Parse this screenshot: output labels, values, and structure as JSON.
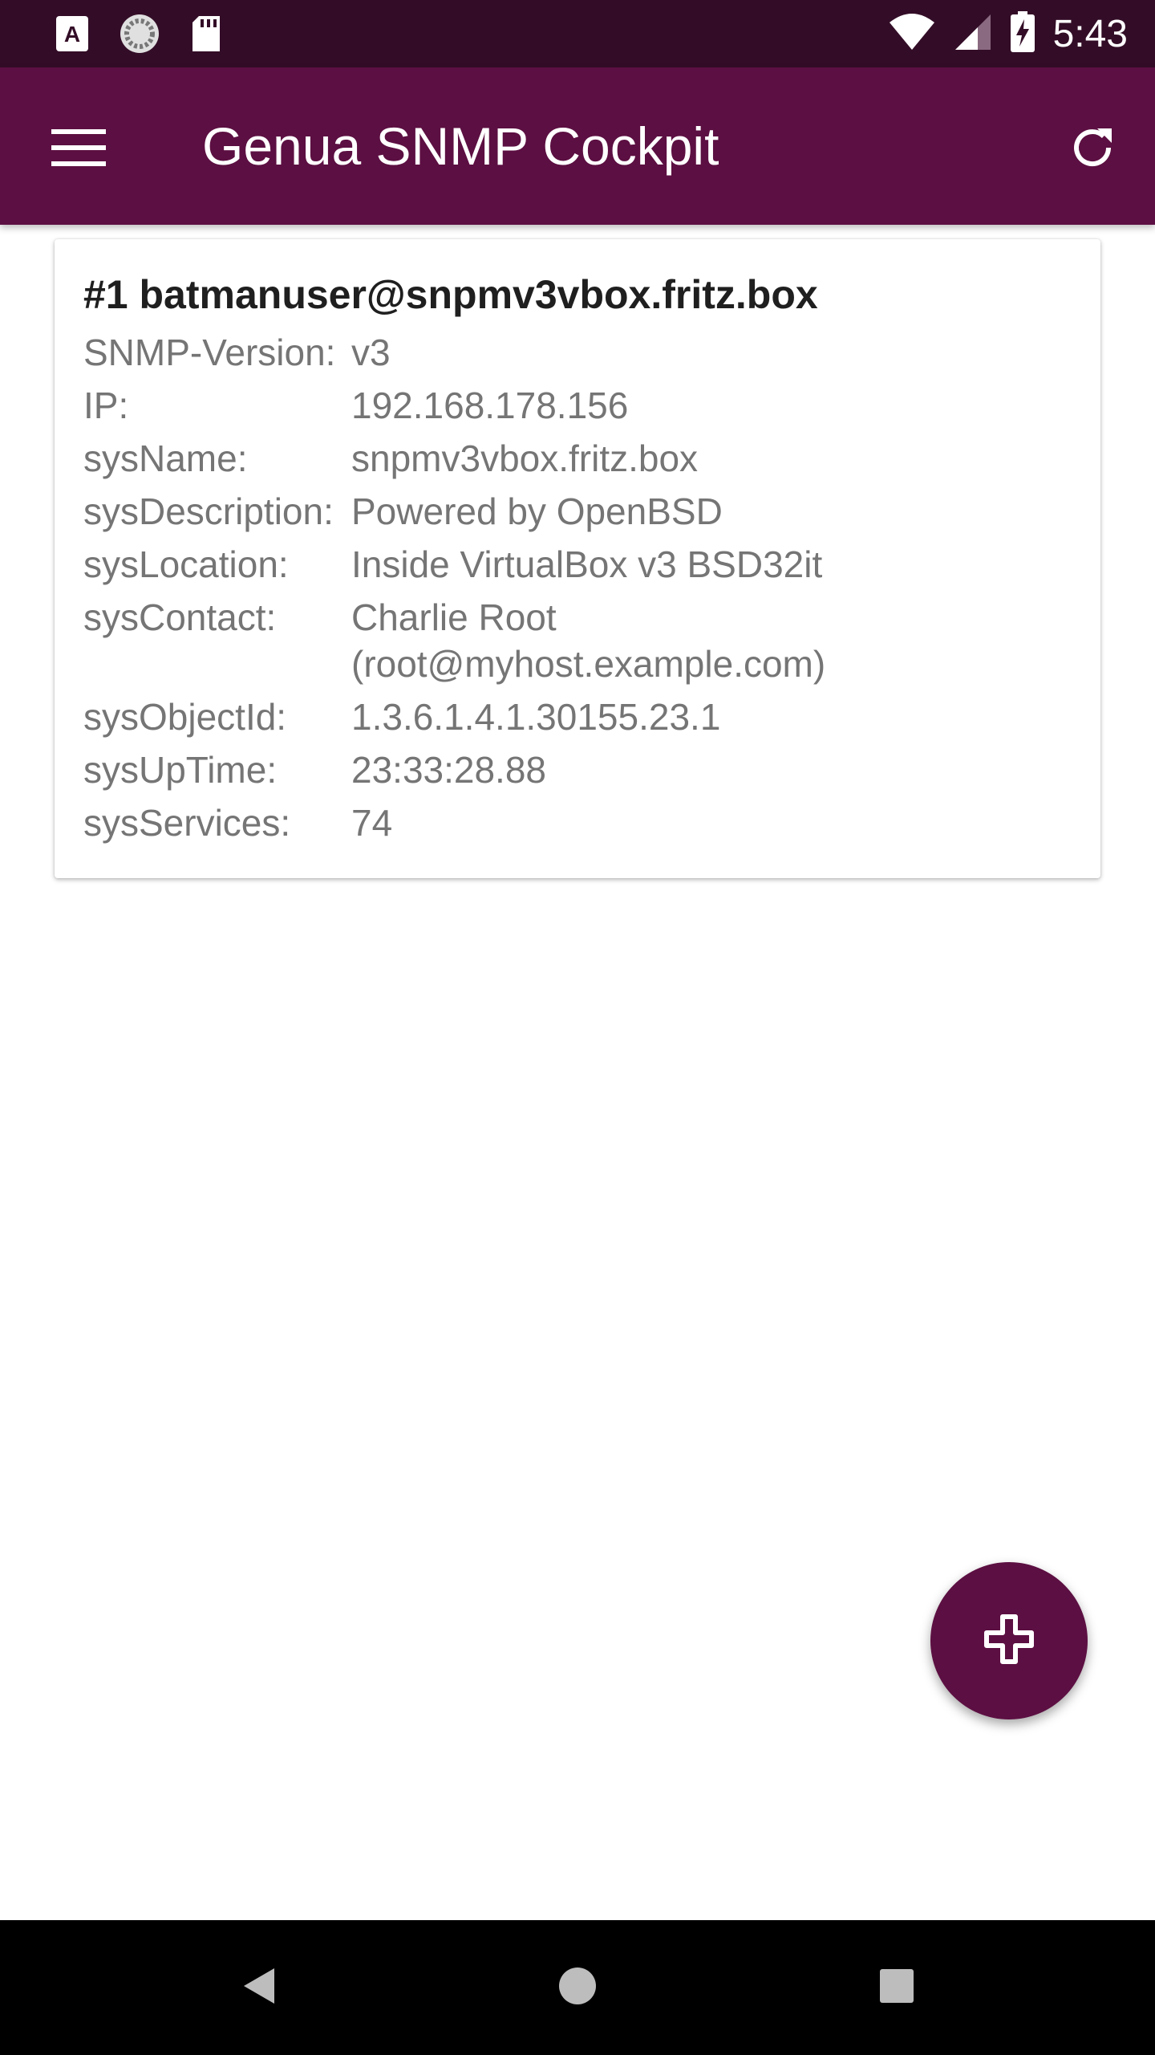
{
  "status_bar": {
    "time": "5:43",
    "icons": [
      "keyboard-a-icon",
      "sync-circle-icon",
      "sd-card-icon",
      "wifi-icon",
      "cell-signal-icon",
      "battery-charging-icon"
    ]
  },
  "app_bar": {
    "title": "Genua SNMP Cockpit",
    "menu_icon": "hamburger-menu-icon",
    "refresh_icon": "refresh-icon"
  },
  "device_card": {
    "title": "#1 batmanuser@snpmv3vbox.fritz.box",
    "rows": [
      {
        "label": "SNMP-Version:",
        "value": "v3"
      },
      {
        "label": "IP:",
        "value": "192.168.178.156"
      },
      {
        "label": "sysName:",
        "value": "snpmv3vbox.fritz.box"
      },
      {
        "label": "sysDescription:",
        "value": "Powered by OpenBSD"
      },
      {
        "label": "sysLocation:",
        "value": "Inside VirtualBox v3 BSD32it"
      },
      {
        "label": "sysContact:",
        "value": "Charlie Root (root@myhost.example.com)"
      },
      {
        "label": "sysObjectId:",
        "value": "1.3.6.1.4.1.30155.23.1"
      },
      {
        "label": "sysUpTime:",
        "value": "23:33:28.88"
      },
      {
        "label": "sysServices:",
        "value": "74"
      }
    ]
  },
  "fab": {
    "icon": "add-icon"
  },
  "colors": {
    "primary": "#5c0f42",
    "status_bar": "#330d27",
    "label_text": "#757575",
    "title_text": "#1f1f1f"
  },
  "nav_bar": {
    "buttons": [
      "back-icon",
      "home-icon",
      "recents-icon"
    ]
  }
}
